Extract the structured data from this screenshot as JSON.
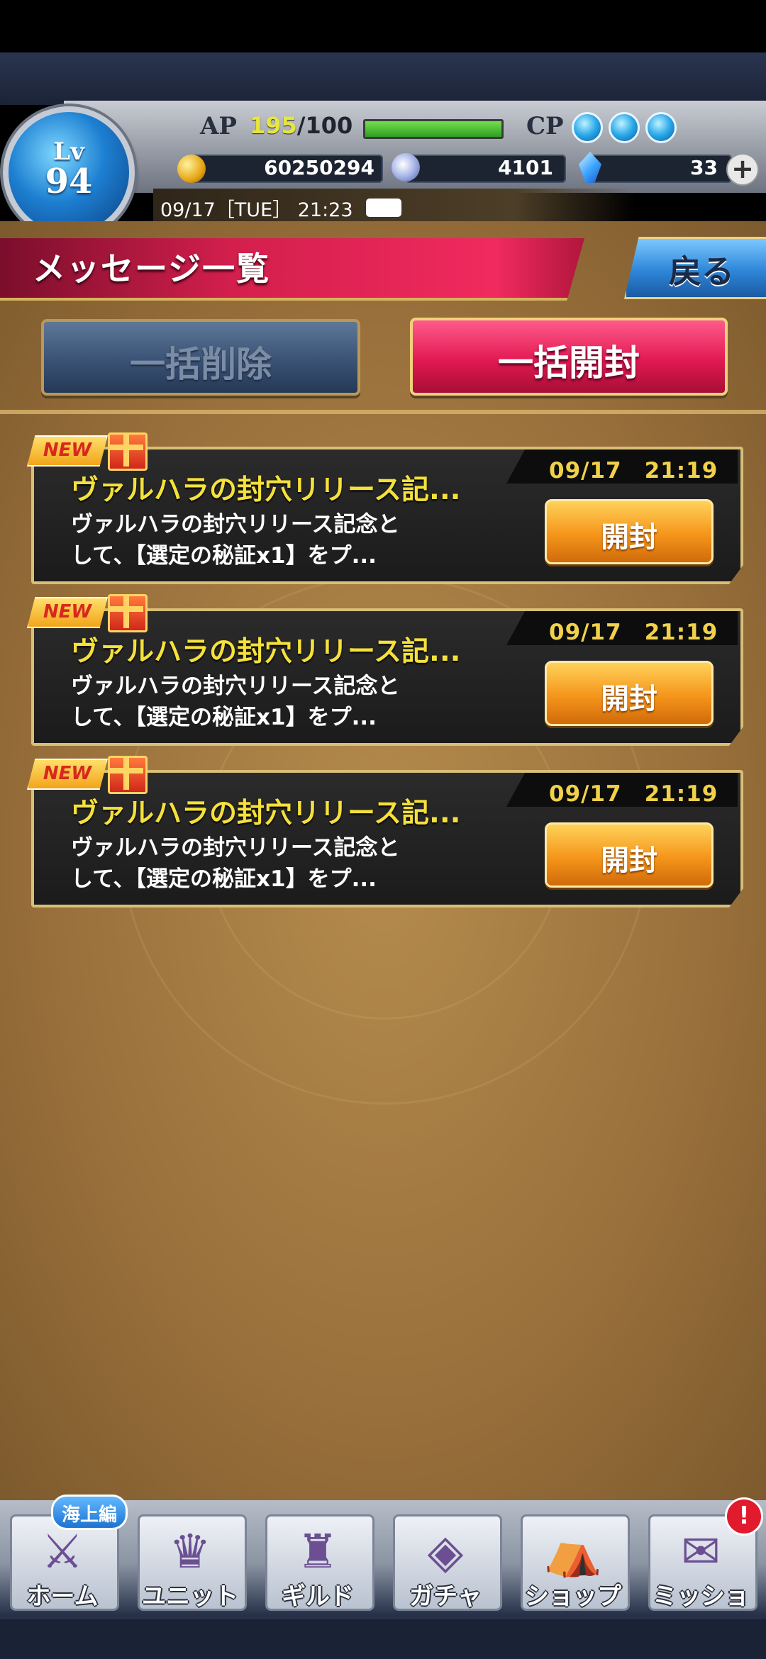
{
  "header": {
    "level_label": "Lv",
    "level": "94",
    "ap_label": "AP",
    "ap_current": "195",
    "ap_max": "/100",
    "ap_fill": 1.0,
    "cp_label": "CP",
    "cp_orbs": 3,
    "gold": "60250294",
    "gems": "4101",
    "crystals": "33",
    "plus": "+",
    "datetime": "09/17［TUE］ 21:23"
  },
  "page": {
    "title": "メッセージ一覧",
    "back_label": "戻る",
    "bulk_delete_label": "一括削除",
    "bulk_open_label": "一括開封"
  },
  "messages": [
    {
      "badge": "NEW",
      "date": "09/17　21:19",
      "title": "ヴァルハラの封穴リリース記...",
      "body_line1": "ヴァルハラの封穴リリース記念と",
      "body_line2": "して、【選定の秘証x1】をプ...",
      "open_label": "開封"
    },
    {
      "badge": "NEW",
      "date": "09/17　21:19",
      "title": "ヴァルハラの封穴リリース記...",
      "body_line1": "ヴァルハラの封穴リリース記念と",
      "body_line2": "して、【選定の秘証x1】をプ...",
      "open_label": "開封"
    },
    {
      "badge": "NEW",
      "date": "09/17　21:19",
      "title": "ヴァルハラの封穴リリース記...",
      "body_line1": "ヴァルハラの封穴リリース記念と",
      "body_line2": "して、【選定の秘証x1】をプ...",
      "open_label": "開封"
    }
  ],
  "nav": {
    "home_tag": "海上編",
    "alert": "!",
    "items": [
      {
        "label": "ホーム",
        "icon": "home-icon"
      },
      {
        "label": "ユニット",
        "icon": "unit-icon"
      },
      {
        "label": "ギルド",
        "icon": "guild-icon"
      },
      {
        "label": "ガチャ",
        "icon": "gacha-icon"
      },
      {
        "label": "ショップ",
        "icon": "shop-icon"
      },
      {
        "label": "ミッション",
        "icon": "mission-icon"
      }
    ]
  }
}
